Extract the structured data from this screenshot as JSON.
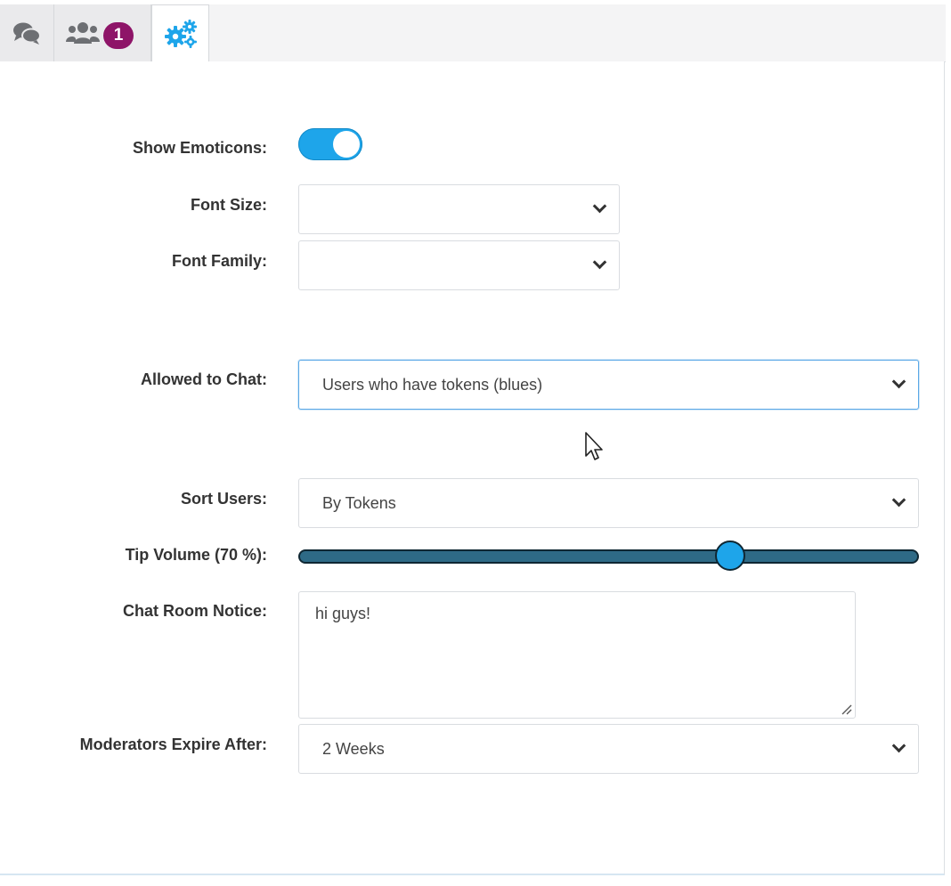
{
  "tabs": {
    "chat_icon": "chat-bubbles-icon",
    "users_icon": "users-icon",
    "users_badge": "1",
    "settings_icon": "gears-icon",
    "active": "settings"
  },
  "settings": {
    "show_emoticons": {
      "label": "Show Emoticons:",
      "enabled": true
    },
    "font_size": {
      "label": "Font Size:",
      "value": ""
    },
    "font_family": {
      "label": "Font Family:",
      "value": ""
    },
    "allowed_to_chat": {
      "label": "Allowed to Chat:",
      "value": "Users who have tokens (blues)"
    },
    "sort_users": {
      "label": "Sort Users:",
      "value": "By Tokens"
    },
    "tip_volume": {
      "label": "Tip Volume (70 %):",
      "percent": 70
    },
    "chat_room_notice": {
      "label": "Chat Room Notice:",
      "value": "hi guys!"
    },
    "moderators_expire": {
      "label": "Moderators Expire After:",
      "value": "2 Weeks"
    }
  },
  "colors": {
    "accent": "#1ea5ea",
    "badge": "#8e1468",
    "slider_track": "#2e6a86"
  }
}
